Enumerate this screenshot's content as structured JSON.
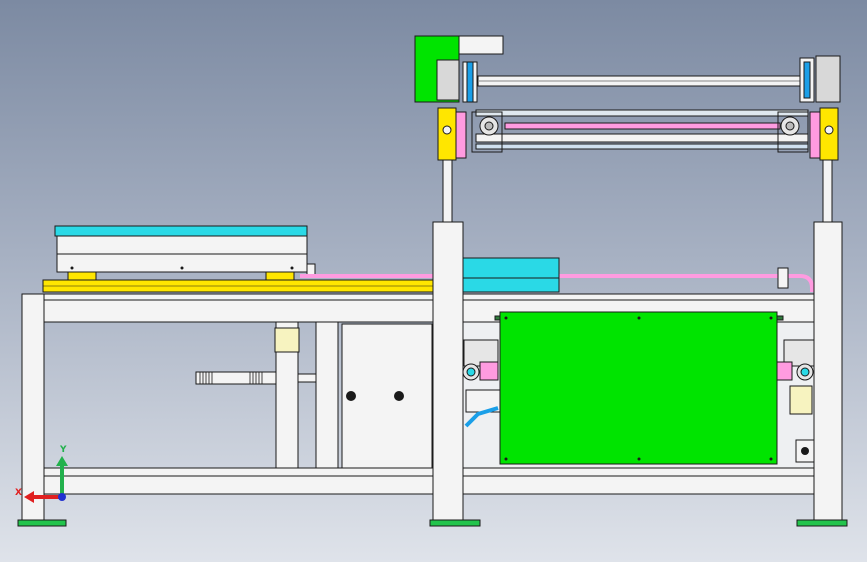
{
  "viewport": {
    "background_top": "#7c8aa2",
    "background_bottom": "#dfe3ea"
  },
  "triad": {
    "y_label": "Y",
    "x_label": "X",
    "y_color": "#22b14c",
    "x_color": "#e02020",
    "z_color": "#2030d0"
  },
  "colors": {
    "frame": "#f4f4f4",
    "outline": "#1a1a1a",
    "green_panel": "#00e400",
    "cyan_plate": "#2ad9e6",
    "yellow_rail": "#ffe600",
    "pink_rod": "#ff9be0",
    "light_yellow": "#f7f3c0",
    "blue_part": "#1a9fe8"
  }
}
